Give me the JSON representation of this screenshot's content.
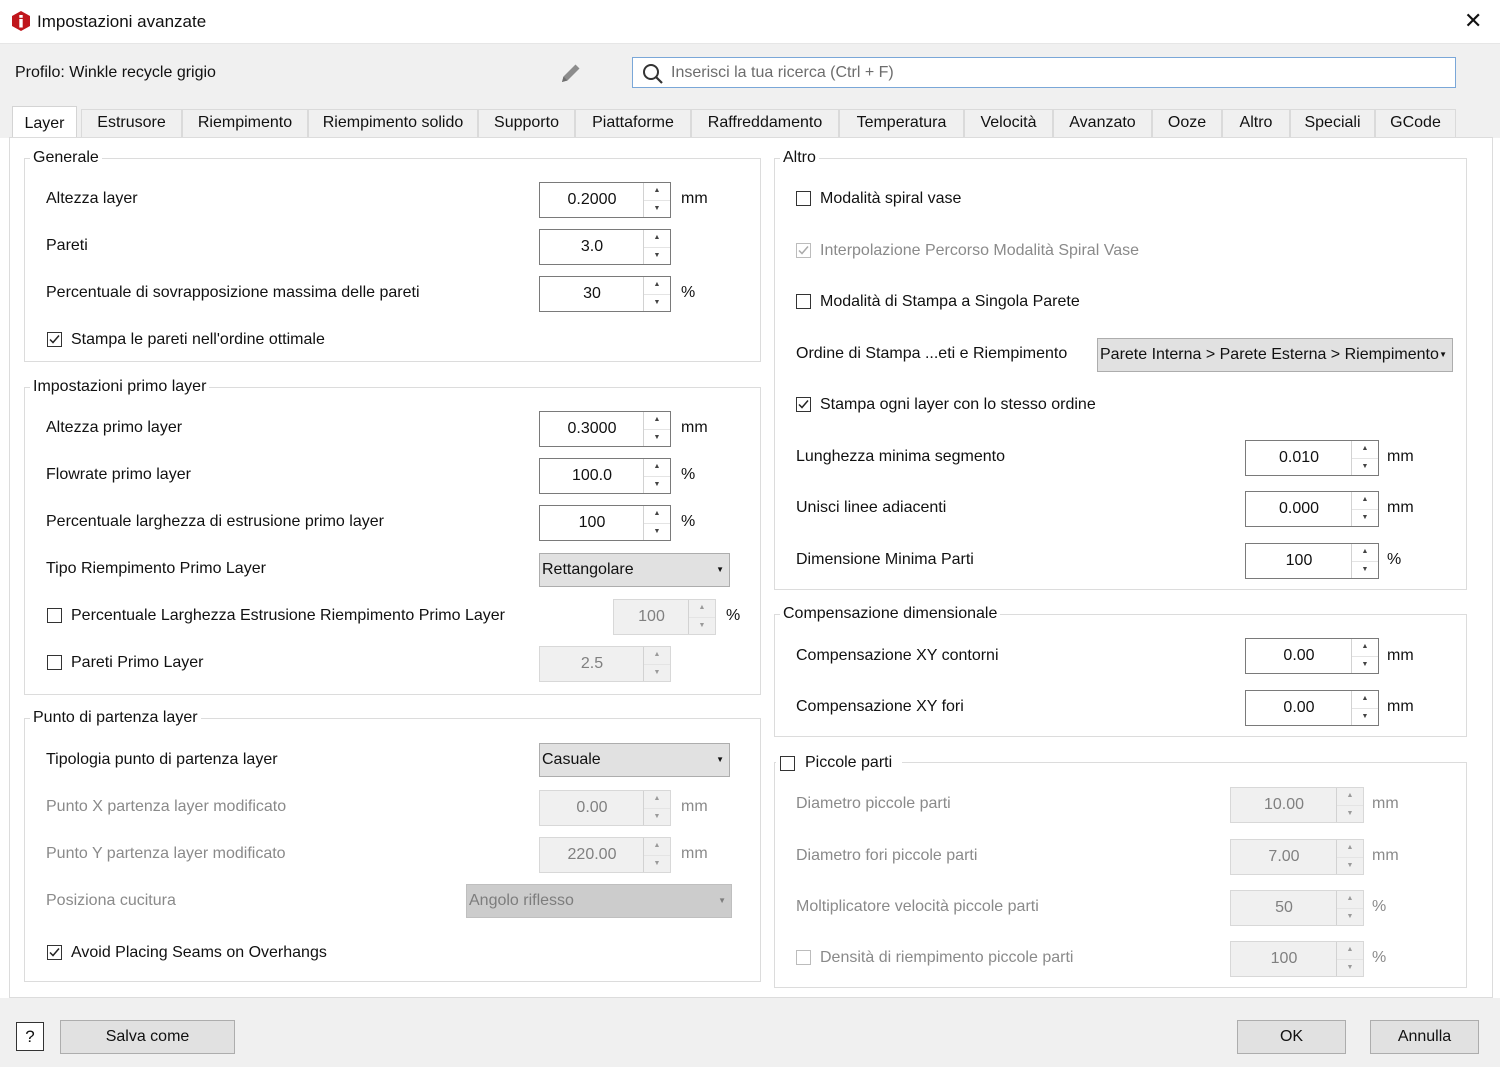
{
  "window": {
    "title": "Impostazioni avanzate"
  },
  "profile": {
    "label": "Profilo: Winkle recycle grigio"
  },
  "search": {
    "placeholder": "Inserisci la tua ricerca (Ctrl + F)"
  },
  "tabs": [
    "Layer",
    "Estrusore",
    "Riempimento",
    "Riempimento solido",
    "Supporto",
    "Piattaforme",
    "Raffreddamento",
    "Temperatura",
    "Velocità",
    "Avanzato",
    "Ooze",
    "Altro",
    "Speciali",
    "GCode"
  ],
  "generale": {
    "title": "Generale",
    "altezza_layer": {
      "label": "Altezza layer",
      "value": "0.2000",
      "unit": "mm"
    },
    "pareti": {
      "label": "Pareti",
      "value": "3.0"
    },
    "sovrapposizione": {
      "label": "Percentuale di sovrapposizione massima delle pareti",
      "value": "30",
      "unit": "%"
    },
    "ordine_ottimale": {
      "label": "Stampa le pareti nell'ordine ottimale",
      "checked": true
    }
  },
  "primo_layer": {
    "title": "Impostazioni primo layer",
    "altezza": {
      "label": "Altezza primo layer",
      "value": "0.3000",
      "unit": "mm"
    },
    "flowrate": {
      "label": "Flowrate primo layer",
      "value": "100.0",
      "unit": "%"
    },
    "larghezza": {
      "label": "Percentuale larghezza di estrusione primo layer",
      "value": "100",
      "unit": "%"
    },
    "tipo_riempimento": {
      "label": "Tipo Riempimento Primo Layer",
      "value": "Rettangolare"
    },
    "larghezza_riempimento": {
      "label": "Percentuale Larghezza Estrusione Riempimento Primo Layer",
      "value": "100",
      "unit": "%",
      "checked": false
    },
    "pareti_primo": {
      "label": "Pareti Primo Layer",
      "value": "2.5",
      "checked": false
    }
  },
  "partenza": {
    "title": "Punto di partenza layer",
    "tipologia": {
      "label": "Tipologia punto di partenza layer",
      "value": "Casuale"
    },
    "punto_x": {
      "label": "Punto X partenza layer modificato",
      "value": "0.00",
      "unit": "mm"
    },
    "punto_y": {
      "label": "Punto Y partenza layer modificato",
      "value": "220.00",
      "unit": "mm"
    },
    "cucitura": {
      "label": "Posiziona cucitura",
      "value": "Angolo riflesso"
    },
    "avoid_seams": {
      "label": "Avoid Placing Seams on Overhangs",
      "checked": true
    }
  },
  "altro": {
    "title": "Altro",
    "spiral_vase": {
      "label": "Modalità spiral vase",
      "checked": false
    },
    "interpolazione": {
      "label": "Interpolazione Percorso Modalità Spiral Vase",
      "checked": true
    },
    "singola_parete": {
      "label": "Modalità di Stampa a Singola Parete",
      "checked": false
    },
    "ordine_stampa": {
      "label": "Ordine di Stampa ...eti e Riempimento",
      "value": "Parete Interna > Parete Esterna > Riempimento"
    },
    "stesso_ordine": {
      "label": "Stampa ogni layer con lo stesso ordine",
      "checked": true
    },
    "lunghezza_min": {
      "label": "Lunghezza minima segmento",
      "value": "0.010",
      "unit": "mm"
    },
    "unisci_linee": {
      "label": "Unisci linee adiacenti",
      "value": "0.000",
      "unit": "mm"
    },
    "dimensione_min": {
      "label": "Dimensione Minima Parti",
      "value": "100",
      "unit": "%"
    }
  },
  "compensazione": {
    "title": "Compensazione dimensionale",
    "xy_contorni": {
      "label": "Compensazione XY contorni",
      "value": "0.00",
      "unit": "mm"
    },
    "xy_fori": {
      "label": "Compensazione XY fori",
      "value": "0.00",
      "unit": "mm"
    }
  },
  "piccole_parti": {
    "title": "Piccole parti",
    "checked": false,
    "diametro": {
      "label": "Diametro piccole parti",
      "value": "10.00",
      "unit": "mm"
    },
    "diametro_fori": {
      "label": "Diametro fori piccole parti",
      "value": "7.00",
      "unit": "mm"
    },
    "moltiplicatore": {
      "label": "Moltiplicatore velocità piccole parti",
      "value": "50",
      "unit": "%"
    },
    "densita": {
      "label": "Densità di riempimento piccole parti",
      "value": "100",
      "unit": "%",
      "checked": false
    }
  },
  "footer": {
    "help": "?",
    "save_as": "Salva come",
    "ok": "OK",
    "cancel": "Annulla"
  },
  "colors": {
    "search_border": "#7aa7d8",
    "icon_red": "#c0161c",
    "panel_bg": "#f0f0f0"
  }
}
